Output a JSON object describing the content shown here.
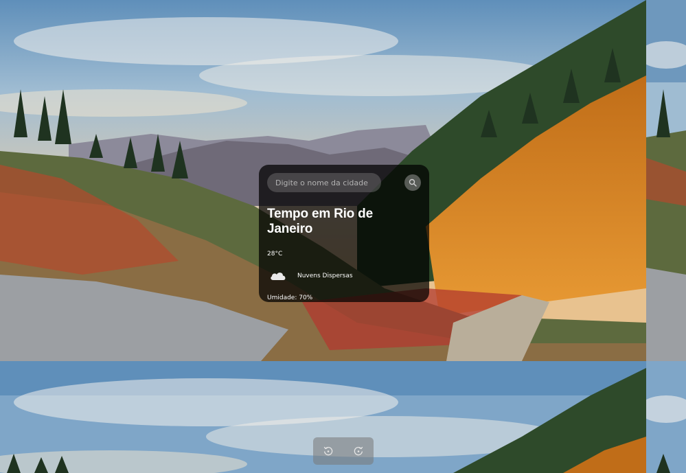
{
  "weather": {
    "search": {
      "placeholder": "Digite o nome da cidade"
    },
    "title": "Tempo em Rio de Janeiro",
    "temperature": "28°C",
    "description": "Nuvens Dispersas",
    "humidity": "Umidade: 70%",
    "icon": "cloud-icon"
  },
  "controls": {
    "previous_icon": "rotate-left-icon",
    "next_icon": "rotate-right-icon"
  },
  "background": {
    "scene": "mountain-landscape",
    "colors": {
      "sky": "#7fa6c8",
      "mountain": "#6c6f85",
      "slope": "#d98320",
      "forest": "#2e4a2a"
    }
  }
}
